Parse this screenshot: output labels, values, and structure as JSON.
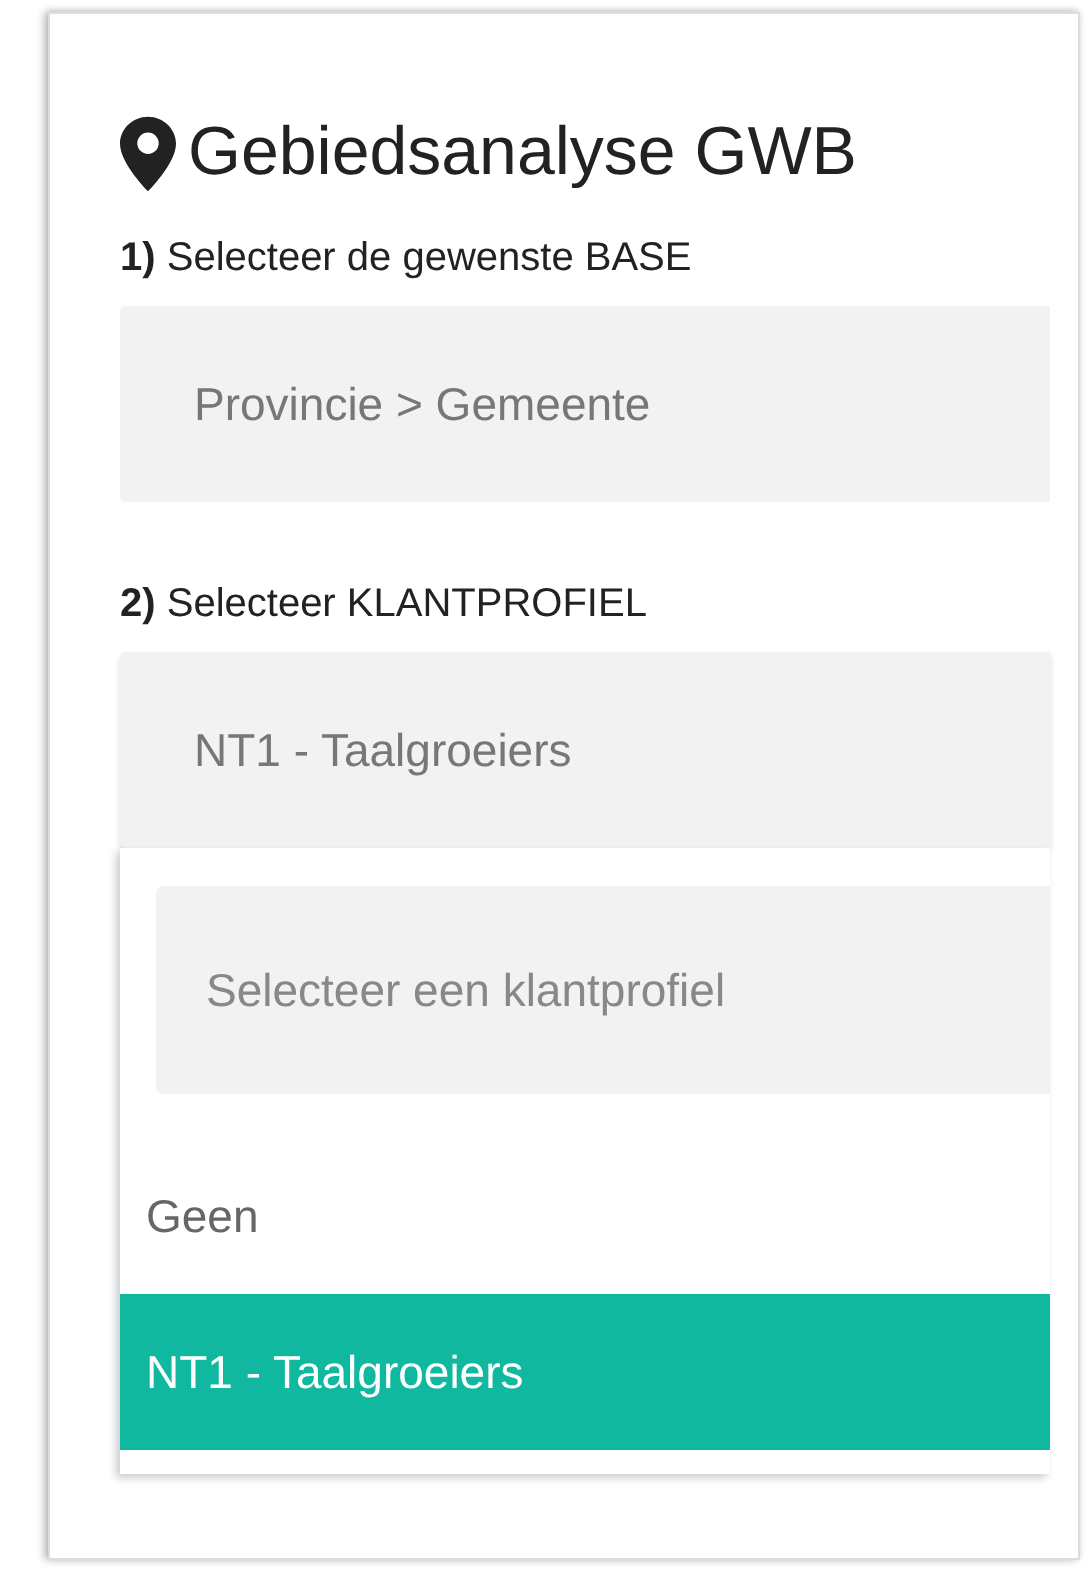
{
  "title": "Gebiedsanalyse GWB",
  "fields": [
    {
      "label": "**1)** Selecteer de gewenste BASE",
      "value": "Provincie > Gemeente",
      "expanded": false
    },
    {
      "label": "**2)** Selecteer KLANTPROFIEL",
      "value": "NT1 - Taalgroeiers",
      "expanded": true
    }
  ],
  "dropdown": {
    "search_placeholder": "Selecteer een klantprofiel",
    "options": [
      {
        "label": "Geen",
        "selected": false
      },
      {
        "label": "NT1 - Taalgroeiers",
        "selected": true
      }
    ]
  }
}
